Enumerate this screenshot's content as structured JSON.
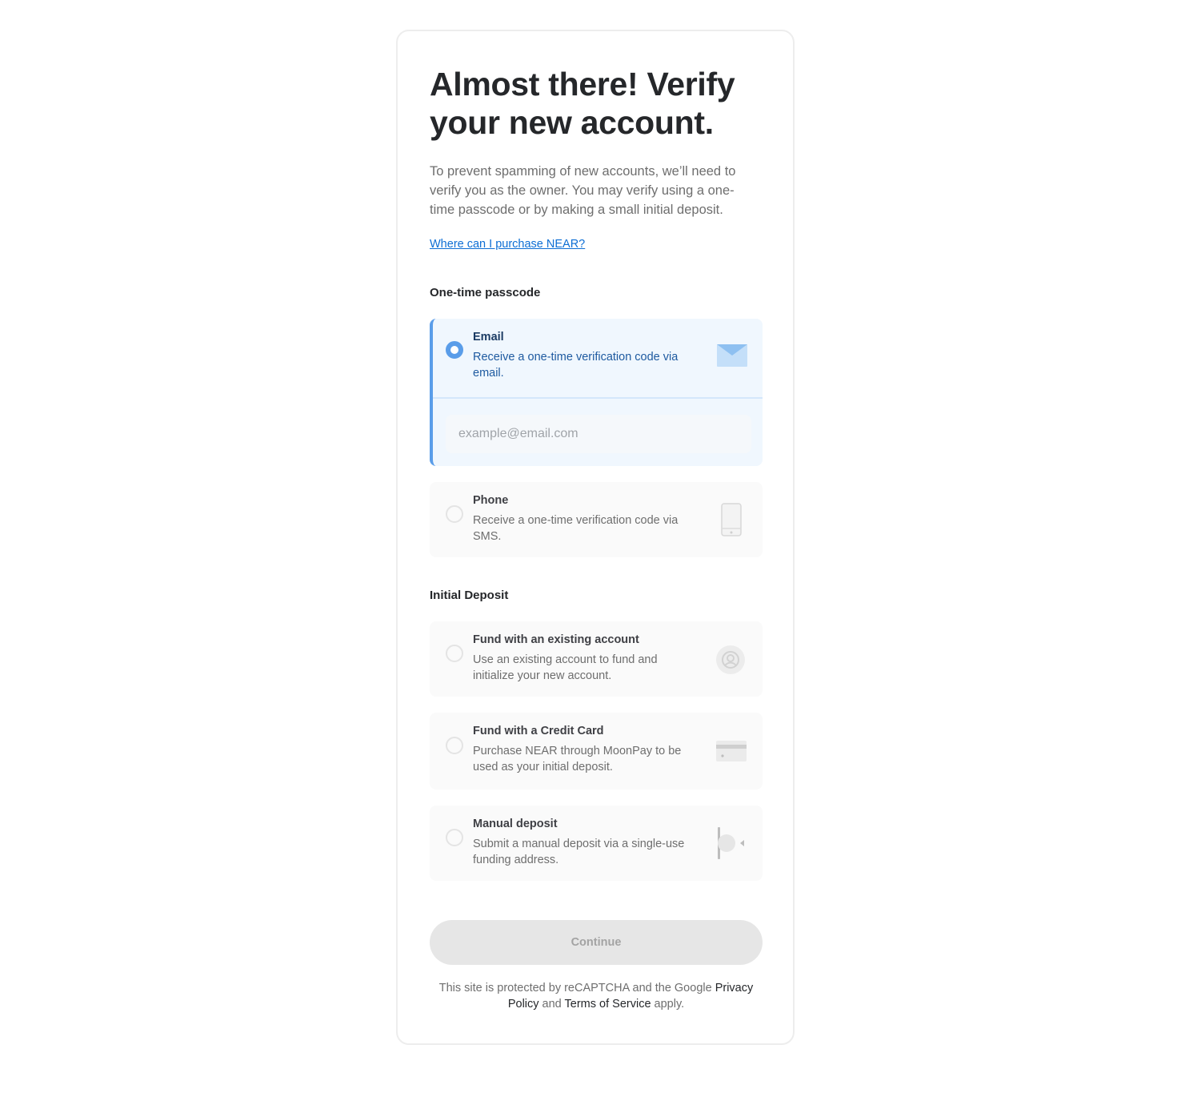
{
  "header": {
    "title": "Almost there! Verify your new account.",
    "description": "To prevent spamming of new accounts, we’ll need to verify you as the owner. You may verify using a one-time passcode or by making a small initial deposit.",
    "purchase_link": "Where can I purchase NEAR?"
  },
  "passcode_section": {
    "label": "One-time passcode",
    "options": [
      {
        "title": "Email",
        "description": "Receive a one-time verification code via email.",
        "icon": "envelope-icon",
        "selected": true,
        "input_placeholder": "example@email.com",
        "input_value": ""
      },
      {
        "title": "Phone",
        "description": "Receive a one-time verification code via SMS.",
        "icon": "phone-icon",
        "selected": false
      }
    ]
  },
  "deposit_section": {
    "label": "Initial Deposit",
    "options": [
      {
        "title": "Fund with an existing account",
        "description": "Use an existing account to fund and initialize your new account.",
        "icon": "account-icon",
        "selected": false
      },
      {
        "title": "Fund with a Credit Card",
        "description": "Purchase NEAR through MoonPay to be used as your initial deposit.",
        "icon": "credit-card-icon",
        "selected": false
      },
      {
        "title": "Manual deposit",
        "description": "Submit a manual deposit via a single-use funding address.",
        "icon": "deposit-icon",
        "selected": false
      }
    ]
  },
  "continue_label": "Continue",
  "footer": {
    "prefix": "This site is protected by reCAPTCHA and the Google",
    "privacy": "Privacy Policy",
    "and": "and",
    "terms": "Terms of Service",
    "suffix": "apply."
  },
  "colors": {
    "accent": "#5a9de9",
    "link": "#0d6ed4",
    "selected_bg": "#f0f7fe",
    "option_bg": "#fafafa",
    "button_disabled": "#e6e6e6"
  }
}
